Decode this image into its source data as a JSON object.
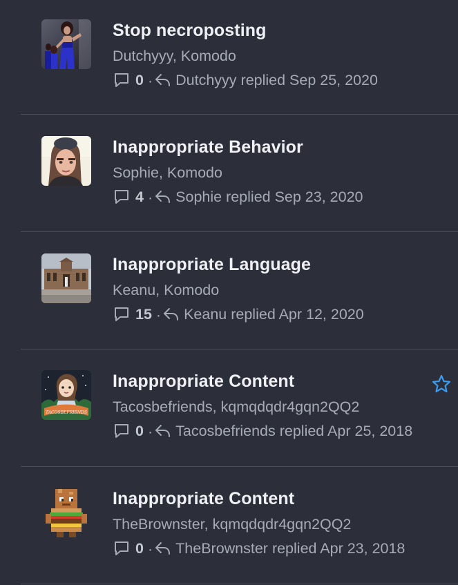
{
  "threads": [
    {
      "title": "Stop necroposting",
      "participants": "Dutchyyy, Komodo",
      "reply_count": "0",
      "last_reply": "Dutchyyy replied Sep 25, 2020",
      "avatar": "performer-photo"
    },
    {
      "title": "Inappropriate Behavior",
      "participants": "Sophie, Komodo",
      "reply_count": "4",
      "last_reply": "Sophie replied Sep 23, 2020",
      "avatar": "selfie-photo"
    },
    {
      "title": "Inappropriate Language",
      "participants": "Keanu, Komodo",
      "reply_count": "15",
      "last_reply": "Keanu replied Apr 12, 2020",
      "avatar": "building-photo"
    },
    {
      "title": "Inappropriate Content",
      "participants": "Tacosbefriends, kqmqdqdr4gqn2QQ2",
      "reply_count": "0",
      "last_reply": "Tacosbefriends replied Apr 25, 2018",
      "avatar": "cartoon-girl-banner",
      "avatar_banner_text": "TACOSBEFRIENDS",
      "watched": true
    },
    {
      "title": "Inappropriate Content",
      "participants": "TheBrownster, kqmqdqdr4gqn2QQ2",
      "reply_count": "0",
      "last_reply": "TheBrownster replied Apr 23, 2018",
      "avatar": "blocky-burger-character"
    }
  ],
  "meta_separator": "·",
  "icons": {
    "replies": "speech-bubble-icon",
    "last_reply": "reply-arrow-icon",
    "watch": "star-icon"
  },
  "colors": {
    "background": "#2c2f39",
    "title": "#eef0f4",
    "secondary_text": "#a7abb6",
    "divider": "#4a4e59",
    "star_accent": "#3b9cf0"
  }
}
